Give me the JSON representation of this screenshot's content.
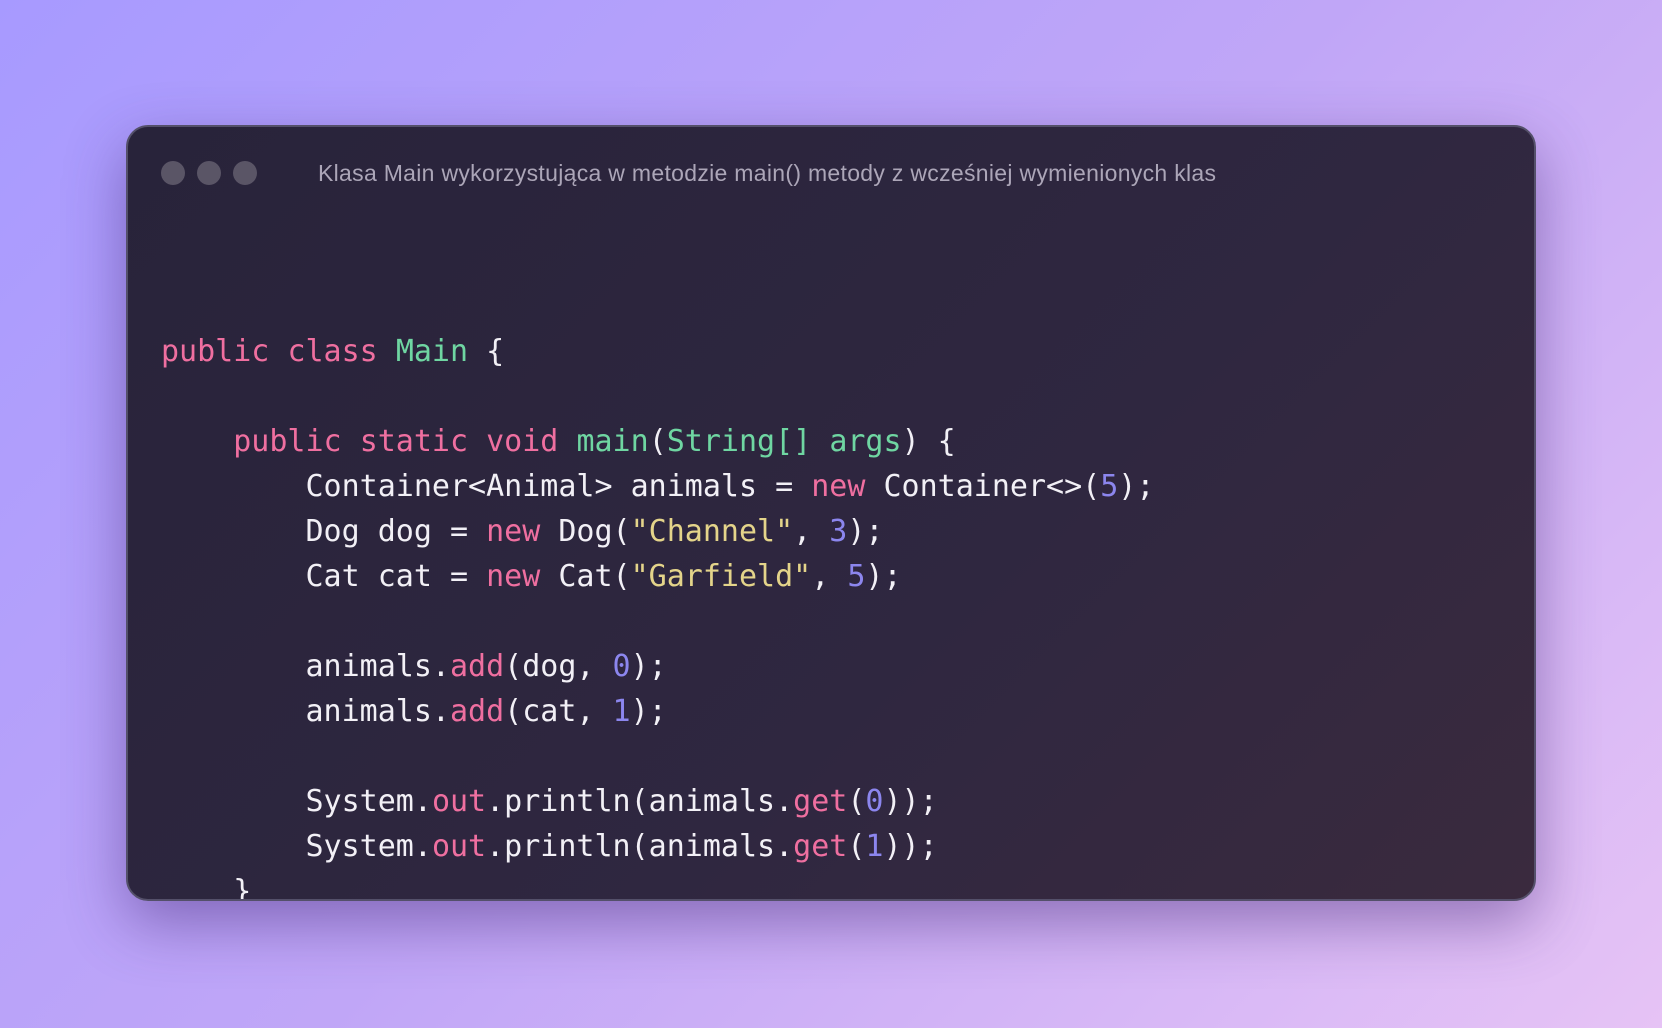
{
  "window": {
    "title": "Klasa Main wykorzystująca w metodzie main() metody z wcześniej wymienionych klas",
    "controls": [
      "close",
      "minimize",
      "maximize"
    ]
  },
  "colors": {
    "keyword": "#ef6fa0",
    "type": "#6fd6a2",
    "string": "#e4d48a",
    "number": "#8c86ee",
    "plain": "#f2f0f6"
  },
  "code": {
    "language": "java",
    "lines": [
      [
        {
          "t": "kw",
          "v": "public"
        },
        {
          "t": "plain",
          "v": " "
        },
        {
          "t": "kw",
          "v": "class"
        },
        {
          "t": "plain",
          "v": " "
        },
        {
          "t": "type",
          "v": "Main"
        },
        {
          "t": "plain",
          "v": " {"
        }
      ],
      [],
      [
        {
          "t": "plain",
          "v": "    "
        },
        {
          "t": "kw",
          "v": "public"
        },
        {
          "t": "plain",
          "v": " "
        },
        {
          "t": "kw",
          "v": "static"
        },
        {
          "t": "plain",
          "v": " "
        },
        {
          "t": "kw",
          "v": "void"
        },
        {
          "t": "plain",
          "v": " "
        },
        {
          "t": "type",
          "v": "main"
        },
        {
          "t": "plain",
          "v": "("
        },
        {
          "t": "type",
          "v": "String[]"
        },
        {
          "t": "plain",
          "v": " "
        },
        {
          "t": "type",
          "v": "args"
        },
        {
          "t": "plain",
          "v": ") {"
        }
      ],
      [
        {
          "t": "plain",
          "v": "        Container<Animal> animals = "
        },
        {
          "t": "kw",
          "v": "new"
        },
        {
          "t": "plain",
          "v": " Container<>("
        },
        {
          "t": "num",
          "v": "5"
        },
        {
          "t": "plain",
          "v": ");"
        }
      ],
      [
        {
          "t": "plain",
          "v": "        Dog dog = "
        },
        {
          "t": "kw",
          "v": "new"
        },
        {
          "t": "plain",
          "v": " Dog("
        },
        {
          "t": "str",
          "v": "\"Channel\""
        },
        {
          "t": "plain",
          "v": ", "
        },
        {
          "t": "num",
          "v": "3"
        },
        {
          "t": "plain",
          "v": ");"
        }
      ],
      [
        {
          "t": "plain",
          "v": "        Cat cat = "
        },
        {
          "t": "kw",
          "v": "new"
        },
        {
          "t": "plain",
          "v": " Cat("
        },
        {
          "t": "str",
          "v": "\"Garfield\""
        },
        {
          "t": "plain",
          "v": ", "
        },
        {
          "t": "num",
          "v": "5"
        },
        {
          "t": "plain",
          "v": ");"
        }
      ],
      [],
      [
        {
          "t": "plain",
          "v": "        animals."
        },
        {
          "t": "kw",
          "v": "add"
        },
        {
          "t": "plain",
          "v": "(dog, "
        },
        {
          "t": "num",
          "v": "0"
        },
        {
          "t": "plain",
          "v": ");"
        }
      ],
      [
        {
          "t": "plain",
          "v": "        animals."
        },
        {
          "t": "kw",
          "v": "add"
        },
        {
          "t": "plain",
          "v": "(cat, "
        },
        {
          "t": "num",
          "v": "1"
        },
        {
          "t": "plain",
          "v": ");"
        }
      ],
      [],
      [
        {
          "t": "plain",
          "v": "        System."
        },
        {
          "t": "kw",
          "v": "out"
        },
        {
          "t": "plain",
          "v": ".println(animals."
        },
        {
          "t": "kw",
          "v": "get"
        },
        {
          "t": "plain",
          "v": "("
        },
        {
          "t": "num",
          "v": "0"
        },
        {
          "t": "plain",
          "v": "));"
        }
      ],
      [
        {
          "t": "plain",
          "v": "        System."
        },
        {
          "t": "kw",
          "v": "out"
        },
        {
          "t": "plain",
          "v": ".println(animals."
        },
        {
          "t": "kw",
          "v": "get"
        },
        {
          "t": "plain",
          "v": "("
        },
        {
          "t": "num",
          "v": "1"
        },
        {
          "t": "plain",
          "v": "));"
        }
      ],
      [
        {
          "t": "plain",
          "v": "    }"
        }
      ],
      [
        {
          "t": "plain",
          "v": "}"
        }
      ]
    ]
  }
}
